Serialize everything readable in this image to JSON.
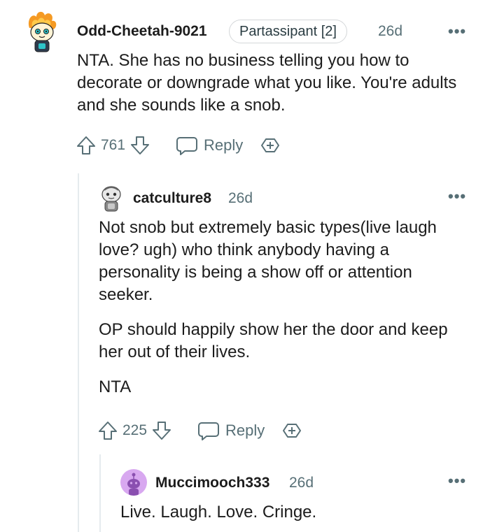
{
  "comments": [
    {
      "author": "Odd-Cheetah-9021",
      "flair": "Partassipant [2]",
      "time": "26d",
      "paragraphs": [
        "NTA. She has no business telling you how to decorate or downgrade what you like. You're adults and she sounds like a snob."
      ],
      "votes": "761",
      "reply_label": "Reply",
      "avatar_icon": "cheetah-avatar-icon"
    },
    {
      "author": "catculture8",
      "time": "26d",
      "paragraphs": [
        "Not snob but extremely basic types(live laugh love? ugh) who think anybody having a personality is being a show off or attention seeker.",
        "OP should happily show her the door and keep her out of their lives.",
        "NTA"
      ],
      "votes": "225",
      "reply_label": "Reply",
      "avatar_icon": "snoo-avatar-icon"
    },
    {
      "author": "Muccimooch333",
      "time": "26d",
      "paragraphs": [
        "Live. Laugh. Love. Cringe."
      ],
      "avatar_icon": "default-snoo-avatar-icon"
    }
  ],
  "more_label": "•••",
  "colors": {
    "text": "#1c1c1c",
    "meta": "#576f76",
    "thread_line": "#e5ebee",
    "purple_avatar": "#d8a8f0"
  }
}
